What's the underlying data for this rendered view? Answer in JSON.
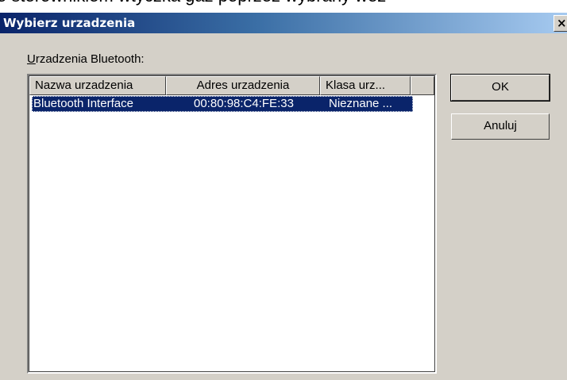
{
  "background": {
    "text": "o sterownikiem wtyczka gaz poprzez wybrany wez"
  },
  "dialog": {
    "title": "Wybierz urzadzenia",
    "close_glyph": "×",
    "group_label_accel": "U",
    "group_label_rest": "rzadzenia Bluetooth:",
    "columns": [
      "Nazwa urzadzenia",
      "Adres urzadzenia",
      "Klasa urz..."
    ],
    "devices": [
      {
        "name": "Bluetooth Interface",
        "address": "00:80:98:C4:FE:33",
        "class": "Nieznane ...",
        "selected": true
      }
    ],
    "buttons": {
      "ok": "OK",
      "cancel": "Anuluj"
    }
  },
  "colors": {
    "titlebar_start": "#0a246a",
    "titlebar_end": "#a6caf0",
    "dialog_face": "#d4d0c8",
    "selection": "#0a246a"
  }
}
